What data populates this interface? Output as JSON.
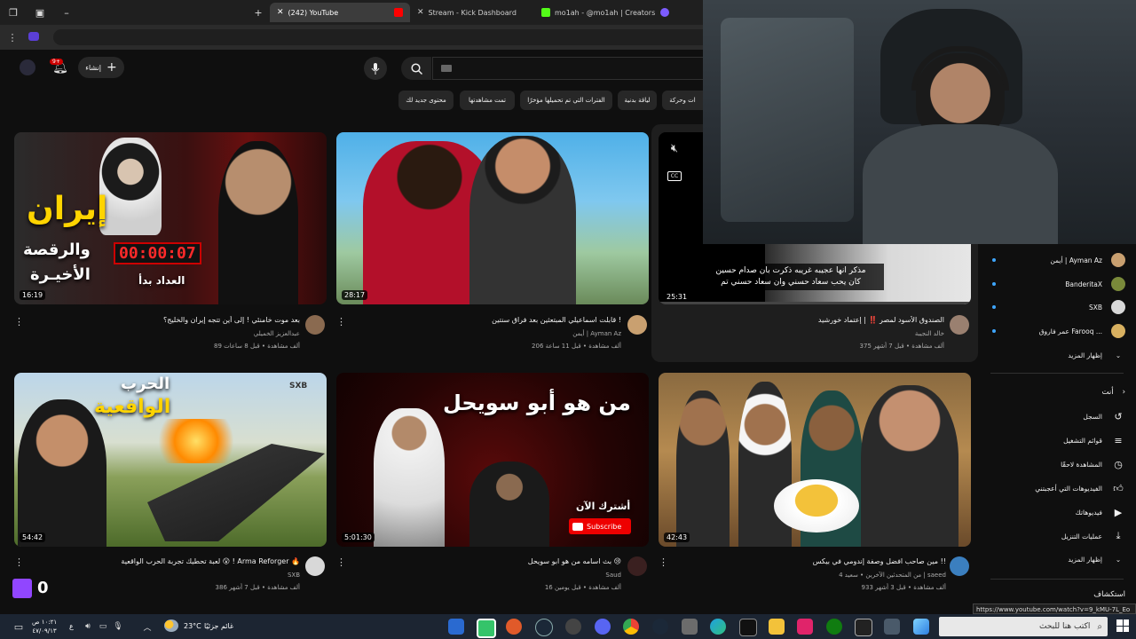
{
  "browser": {
    "tabs": [
      {
        "label": "(242) YouTube",
        "favicon_color": "#ff0000"
      },
      {
        "label": "Stream - Kick Dashboard",
        "favicon_color": "#e0245e"
      },
      {
        "label": "mo1ah - @mo1ah | Creators",
        "favicon_color": "#53fc18"
      }
    ],
    "new_tab_icon": "plus-icon"
  },
  "youtube": {
    "create_label": "إنشاء",
    "notif_badge": "9+",
    "search_placeholder": "",
    "chips": [
      "محتوى جديد لك",
      "تمت مشاهدتها",
      "الفترات التي تم تحميلها مؤخرًا",
      "لياقة بدنية",
      "ات وحركة"
    ],
    "videos": [
      {
        "title": "بعد موت خامنئي ! إلى أين تتجه إيران والخليج؟",
        "channel": "عبدالعزيز الخميلي",
        "meta": "89 ألف مشاهدة • قبل 8 ساعات",
        "duration": "16:19",
        "thumb_text": "إيران",
        "thumb_text2": "والرقصة",
        "thumb_text3": "الأخيـرة",
        "thumb_text4": "العداد بدأ",
        "timer": "00:00:07"
      },
      {
        "title": "قابلت اسماعيلي المبتعثين بعد فراق سنتين !",
        "channel": "أيمن | Ayman Az",
        "meta": "206 ألف مشاهدة • قبل 11 ساعة",
        "duration": "28:17"
      },
      {
        "title": "الصندوق الأسود لمصر ‼️ | إعتماد خورشيد",
        "channel": "خالد النجيبة",
        "meta": "375 ألف مشاهدة • قبل 7 أشهر",
        "duration": "25:31",
        "caption_line1": "مذكر انها عجيبه غريبه ذكرت بان صدام حسين",
        "caption_line2": "كان يحب سعاد حسني وان سعاد حسني تم"
      },
      {
        "title": "لعبة تحطيك تجربة الحرب الواقعية 😮 ! Arma Reforger 🔥",
        "channel": "SXB",
        "meta": "386 ألف مشاهدة • قبل 7 أشهر",
        "duration": "54:42",
        "thumb_text": "الحرب",
        "thumb_text2": "الواقعية",
        "thumb_text3": "SXB"
      },
      {
        "title": "بث اسامه من هو ابو سويحل 😢",
        "channel": "Saud",
        "meta": "16 ألف مشاهدة • قبل يومين",
        "duration": "5:01:30",
        "thumb_text": "من هو أبو سويحل",
        "thumb_text2": "أشترك الآن",
        "subscribe_label": "Subscribe"
      },
      {
        "title": "مين صاحب افضل وصفة إندومي في بيكس !!",
        "channel": "سعيد | saeed",
        "meta": "933 ألف مشاهدة • قبل 3 أشهر",
        "duration": "42:43",
        "extra": "4 من المتحدثين الآخرين"
      }
    ],
    "sidebar": {
      "subscriptions": [
        {
          "label": "أيمن | Ayman Az",
          "color": "#c9a070"
        },
        {
          "label": "BanderitaX",
          "color": "#7a8a3a"
        },
        {
          "label": "SXB",
          "color": "#d8d8d8"
        },
        {
          "label": "عمر فاروق Farooq ...",
          "color": "#d8b060"
        }
      ],
      "show_more_1": "إظهار المزيد",
      "you_header": "أنت",
      "you_items": [
        {
          "label": "السجل",
          "icon": "history-icon"
        },
        {
          "label": "قوائم التشغيل",
          "icon": "playlist-icon"
        },
        {
          "label": "المشاهدة لاحقًا",
          "icon": "clock-icon"
        },
        {
          "label": "الفيديوهات التي أعجبتني",
          "icon": "thumb-up-icon"
        },
        {
          "label": "فيديوهاتك",
          "icon": "video-icon"
        },
        {
          "label": "عمليات التنزيل",
          "icon": "download-icon"
        }
      ],
      "show_more_2": "إظهار المزيد",
      "explore": "استكشاف"
    },
    "status_url": "https://www.youtube.com/watch?v=9_kMU-7L_Eo"
  },
  "overlay": {
    "twitch_count": "0"
  },
  "taskbar": {
    "search_placeholder": "اكتب هنا للبحث",
    "weather_text": "غائم جزئيًا",
    "temperature": "23°C",
    "time": "١٠:٢١ ص",
    "date": "٤٧/٠٩/١٣",
    "lang": "ع"
  }
}
